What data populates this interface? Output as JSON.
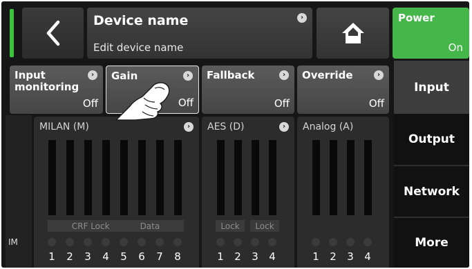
{
  "header": {
    "device_title": "Device name",
    "device_subtitle": "Edit device name",
    "power_label": "Power",
    "power_value": "On",
    "status_color": "#3cc23c",
    "power_color": "#45b649"
  },
  "settings": [
    {
      "label": "Input monitoring",
      "value": "Off"
    },
    {
      "label": "Gain",
      "value": "Off"
    },
    {
      "label": "Fallback",
      "value": "Off"
    },
    {
      "label": "Override",
      "value": "Off"
    }
  ],
  "nav": {
    "input": "Input",
    "output": "Output",
    "network": "Network",
    "more": "More"
  },
  "meters": {
    "im_label": "IM",
    "milan": {
      "title": "MILAN (M)",
      "crf_lock": "CRF Lock",
      "data": "Data",
      "channels": [
        "1",
        "2",
        "3",
        "4",
        "5",
        "6",
        "7",
        "8"
      ]
    },
    "aes": {
      "title": "AES (D)",
      "lock1": "Lock",
      "lock2": "Lock",
      "channels": [
        "1",
        "2",
        "3",
        "4"
      ]
    },
    "analog": {
      "title": "Analog (A)",
      "channels": [
        "1",
        "2",
        "3",
        "4"
      ]
    }
  },
  "icons": [
    "back-arrow-icon",
    "home-icon",
    "info-icon",
    "pointing-hand-icon"
  ]
}
